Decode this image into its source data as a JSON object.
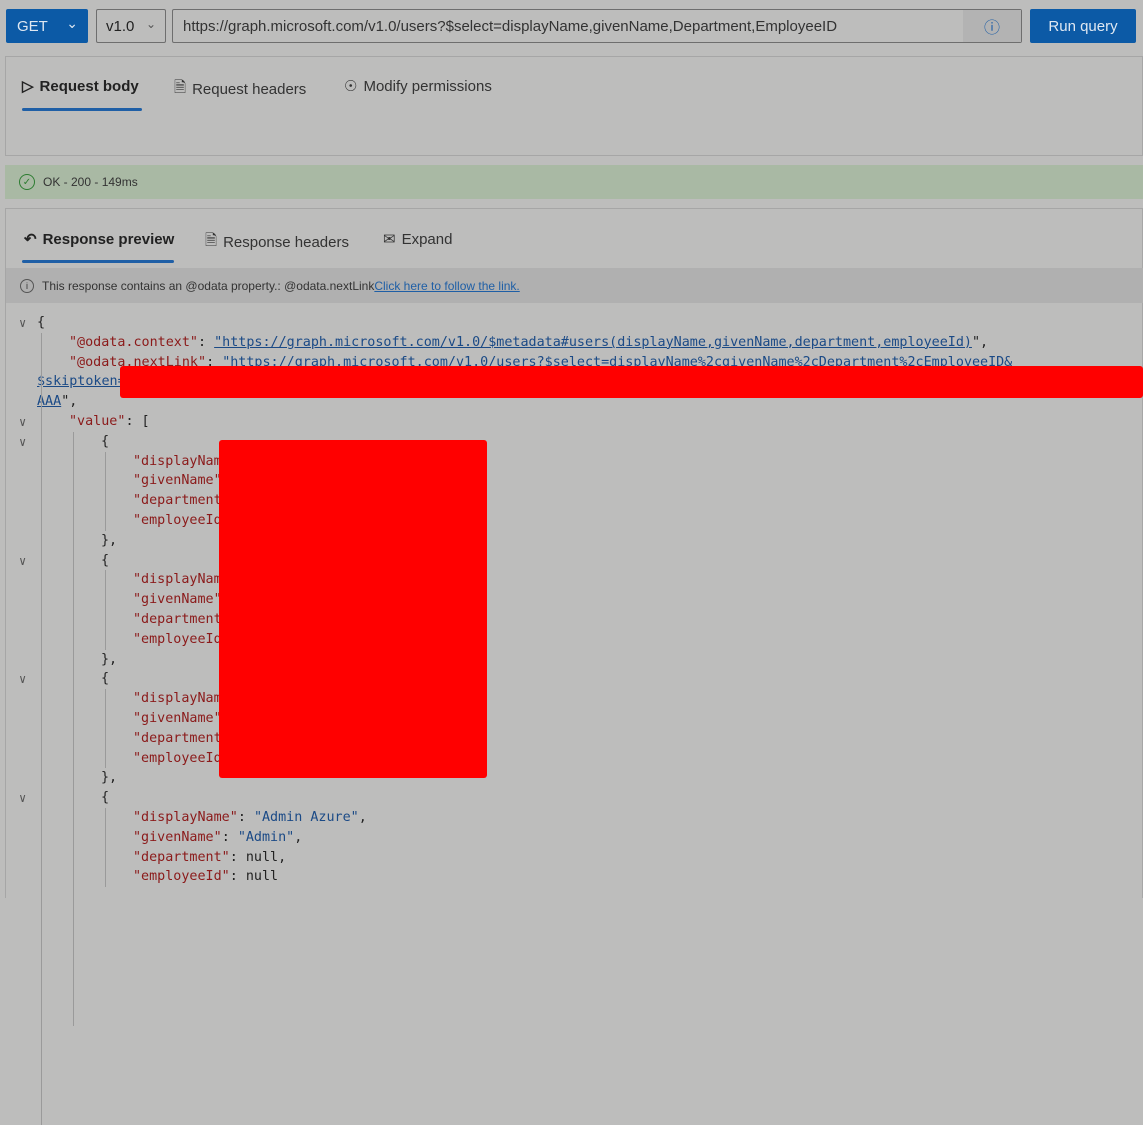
{
  "toolbar": {
    "method": "GET",
    "version": "v1.0",
    "url": "https://graph.microsoft.com/v1.0/users?$select=displayName,givenName,Department,EmployeeID",
    "run_label": "Run query"
  },
  "request_tabs": [
    {
      "label": "Request body",
      "icon": "send-icon"
    },
    {
      "label": "Request headers",
      "icon": "document-icon"
    },
    {
      "label": "Modify permissions",
      "icon": "lock-icon"
    }
  ],
  "status": {
    "text": "OK - 200 - 149ms",
    "color": "#2e7d32"
  },
  "response_tabs": [
    {
      "label": "Response preview",
      "icon": "undo-icon"
    },
    {
      "label": "Response headers",
      "icon": "document-icon"
    },
    {
      "label": "Expand",
      "icon": "expand-icon"
    }
  ],
  "info_bar": {
    "text": "This response contains an @odata property.: @odata.nextLink",
    "link": " Click here to follow the link."
  },
  "code_lines": [
    {
      "l": 0,
      "c": true,
      "t": [
        [
          "p",
          "{"
        ]
      ]
    },
    {
      "l": 1,
      "t": [
        [
          "k",
          "\"@odata.context\""
        ],
        [
          "p",
          ": "
        ],
        [
          "s",
          "\"https://graph.microsoft.com/v1.0/$metadata#users(displayName,givenName,department,employeeId)"
        ],
        [
          "p",
          "\","
        ]
      ]
    },
    {
      "l": 1,
      "t": [
        [
          "k",
          "\"@odata.nextLink\""
        ],
        [
          "p",
          ": "
        ],
        [
          "s",
          "\"https://graph.microsoft.com/v1.0/users?$select=displayName%2cgivenName%2cDepartment%2cEmployeeID&"
        ]
      ]
    },
    {
      "l": 0,
      "t": [
        [
          "s",
          "$skiptoken="
        ]
      ]
    },
    {
      "l": 0,
      "t": [
        [
          "s",
          "AAA"
        ],
        [
          "p",
          "\","
        ]
      ]
    },
    {
      "l": 1,
      "c": true,
      "t": [
        [
          "k",
          "\"value\""
        ],
        [
          "p",
          ": ["
        ]
      ]
    },
    {
      "l": 2,
      "c": true,
      "t": [
        [
          "p",
          "{"
        ]
      ]
    },
    {
      "l": 3,
      "t": [
        [
          "k",
          "\"displayName\""
        ]
      ]
    },
    {
      "l": 3,
      "t": [
        [
          "k",
          "\"givenName\""
        ]
      ]
    },
    {
      "l": 3,
      "t": [
        [
          "k",
          "\"department\""
        ]
      ]
    },
    {
      "l": 3,
      "t": [
        [
          "k",
          "\"employeeId\""
        ]
      ]
    },
    {
      "l": 2,
      "t": [
        [
          "p",
          "},"
        ]
      ]
    },
    {
      "l": 2,
      "c": true,
      "t": [
        [
          "p",
          "{"
        ]
      ]
    },
    {
      "l": 3,
      "t": [
        [
          "k",
          "\"displayName\""
        ]
      ]
    },
    {
      "l": 3,
      "t": [
        [
          "k",
          "\"givenName\""
        ]
      ]
    },
    {
      "l": 3,
      "t": [
        [
          "k",
          "\"department\""
        ]
      ]
    },
    {
      "l": 3,
      "t": [
        [
          "k",
          "\"employeeId\""
        ]
      ]
    },
    {
      "l": 2,
      "t": [
        [
          "p",
          "},"
        ]
      ]
    },
    {
      "l": 2,
      "c": true,
      "t": [
        [
          "p",
          "{"
        ]
      ]
    },
    {
      "l": 3,
      "t": [
        [
          "k",
          "\"displayName\""
        ]
      ]
    },
    {
      "l": 3,
      "t": [
        [
          "k",
          "\"givenName\""
        ]
      ]
    },
    {
      "l": 3,
      "t": [
        [
          "k",
          "\"department\""
        ]
      ]
    },
    {
      "l": 3,
      "t": [
        [
          "k",
          "\"employeeId\""
        ]
      ]
    },
    {
      "l": 2,
      "t": [
        [
          "p",
          "},"
        ]
      ]
    },
    {
      "l": 2,
      "c": true,
      "t": [
        [
          "p",
          "{"
        ]
      ]
    },
    {
      "l": 3,
      "t": [
        [
          "k",
          "\"displayName\""
        ],
        [
          "p",
          ": "
        ],
        [
          "n",
          "\"Admin Azure\""
        ],
        [
          "p",
          ","
        ]
      ]
    },
    {
      "l": 3,
      "t": [
        [
          "k",
          "\"givenName\""
        ],
        [
          "p",
          ": "
        ],
        [
          "n",
          "\"Admin\""
        ],
        [
          "p",
          ","
        ]
      ]
    },
    {
      "l": 3,
      "t": [
        [
          "k",
          "\"department\""
        ],
        [
          "p",
          ": null,"
        ]
      ]
    },
    {
      "l": 3,
      "t": [
        [
          "k",
          "\"employeeId\""
        ],
        [
          "p",
          ": null"
        ]
      ]
    }
  ]
}
